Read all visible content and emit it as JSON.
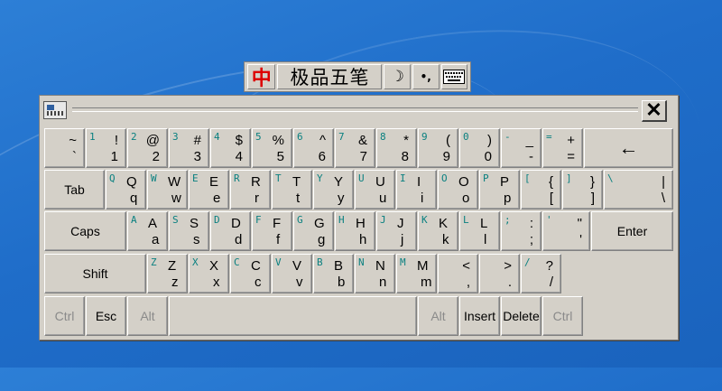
{
  "ime_bar": {
    "logo": "中",
    "name": "极品五笔",
    "moon_icon": "☽",
    "punct_icon": "•,",
    "keyboard_icon": "keyboard-icon"
  },
  "osk": {
    "close": "✕",
    "rows": [
      [
        {
          "up": "~",
          "lo": "`"
        },
        {
          "ime": "1",
          "up": "!",
          "lo": "1"
        },
        {
          "ime": "2",
          "up": "@",
          "lo": "2"
        },
        {
          "ime": "3",
          "up": "#",
          "lo": "3"
        },
        {
          "ime": "4",
          "up": "$",
          "lo": "4"
        },
        {
          "ime": "5",
          "up": "%",
          "lo": "5"
        },
        {
          "ime": "6",
          "up": "^",
          "lo": "6"
        },
        {
          "ime": "7",
          "up": "&",
          "lo": "7"
        },
        {
          "ime": "8",
          "up": "*",
          "lo": "8"
        },
        {
          "ime": "9",
          "up": "(",
          "lo": "9"
        },
        {
          "ime": "0",
          "up": ")",
          "lo": "0"
        },
        {
          "ime": "-",
          "up": "_",
          "lo": "-"
        },
        {
          "ime": "=",
          "up": "+",
          "lo": "="
        },
        {
          "label": "←",
          "big": true
        }
      ],
      [
        {
          "label": "Tab"
        },
        {
          "ime": "Q",
          "up": "Q",
          "lo": "q"
        },
        {
          "ime": "W",
          "up": "W",
          "lo": "w"
        },
        {
          "ime": "E",
          "up": "E",
          "lo": "e"
        },
        {
          "ime": "R",
          "up": "R",
          "lo": "r"
        },
        {
          "ime": "T",
          "up": "T",
          "lo": "t"
        },
        {
          "ime": "Y",
          "up": "Y",
          "lo": "y"
        },
        {
          "ime": "U",
          "up": "U",
          "lo": "u"
        },
        {
          "ime": "I",
          "up": "I",
          "lo": "i"
        },
        {
          "ime": "O",
          "up": "O",
          "lo": "o"
        },
        {
          "ime": "P",
          "up": "P",
          "lo": "p"
        },
        {
          "ime": "[",
          "up": "{",
          "lo": "["
        },
        {
          "ime": "]",
          "up": "}",
          "lo": "]"
        },
        {
          "ime": "\\",
          "up": "|",
          "lo": "\\"
        }
      ],
      [
        {
          "label": "Caps"
        },
        {
          "ime": "A",
          "up": "A",
          "lo": "a"
        },
        {
          "ime": "S",
          "up": "S",
          "lo": "s"
        },
        {
          "ime": "D",
          "up": "D",
          "lo": "d"
        },
        {
          "ime": "F",
          "up": "F",
          "lo": "f"
        },
        {
          "ime": "G",
          "up": "G",
          "lo": "g"
        },
        {
          "ime": "H",
          "up": "H",
          "lo": "h"
        },
        {
          "ime": "J",
          "up": "J",
          "lo": "j"
        },
        {
          "ime": "K",
          "up": "K",
          "lo": "k"
        },
        {
          "ime": "L",
          "up": "L",
          "lo": "l"
        },
        {
          "ime": ";",
          "up": ":",
          "lo": ";"
        },
        {
          "ime": "'",
          "up": "\"",
          "lo": "'"
        },
        {
          "label": "Enter"
        }
      ],
      [
        {
          "label": "Shift"
        },
        {
          "ime": "Z",
          "up": "Z",
          "lo": "z"
        },
        {
          "ime": "X",
          "up": "X",
          "lo": "x"
        },
        {
          "ime": "C",
          "up": "C",
          "lo": "c"
        },
        {
          "ime": "V",
          "up": "V",
          "lo": "v"
        },
        {
          "ime": "B",
          "up": "B",
          "lo": "b"
        },
        {
          "ime": "N",
          "up": "N",
          "lo": "n"
        },
        {
          "ime": "M",
          "up": "M",
          "lo": "m"
        },
        {
          "up": "<",
          "lo": ","
        },
        {
          "up": ">",
          "lo": "."
        },
        {
          "ime": "/",
          "up": "?",
          "lo": "/"
        }
      ],
      [
        {
          "label": "Ctrl",
          "disabled": true
        },
        {
          "label": "Esc"
        },
        {
          "label": "Alt",
          "disabled": true
        },
        {
          "label": ""
        },
        {
          "label": "Alt",
          "disabled": true
        },
        {
          "label": "Insert"
        },
        {
          "label": "Delete"
        },
        {
          "label": "Ctrl",
          "disabled": true
        }
      ]
    ]
  }
}
